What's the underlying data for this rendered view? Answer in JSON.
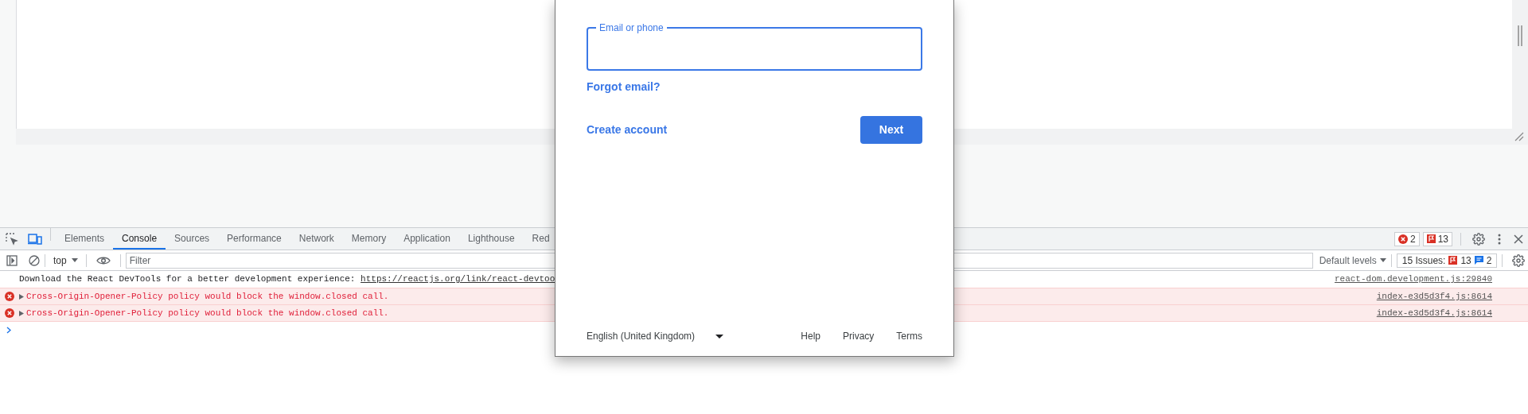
{
  "signin_dialog": {
    "email_field": {
      "label": "Email or phone"
    },
    "forgot_link": "Forgot email?",
    "create_account_link": "Create account",
    "next_button": "Next",
    "language_select": {
      "value": "English (United Kingdom)"
    },
    "footer_links": [
      "Help",
      "Privacy",
      "Terms"
    ]
  },
  "devtools": {
    "tabs": [
      {
        "label": "Elements",
        "selected": false
      },
      {
        "label": "Console",
        "selected": true
      },
      {
        "label": "Sources",
        "selected": false
      },
      {
        "label": "Performance",
        "selected": false
      },
      {
        "label": "Network",
        "selected": false
      },
      {
        "label": "Memory",
        "selected": false
      },
      {
        "label": "Application",
        "selected": false
      },
      {
        "label": "Lighthouse",
        "selected": false
      },
      {
        "label": "Red",
        "selected": false
      }
    ],
    "error_count": "2",
    "issue_count": "13",
    "toolbar": {
      "context": "top",
      "filter": {
        "placeholder": "Filter"
      },
      "levels": "Default levels",
      "issues": {
        "label": "15 Issues:",
        "errors": "13",
        "infos": "2"
      }
    },
    "messages": [
      {
        "kind": "info",
        "text": "Download the React DevTools for a better development experience: ",
        "link": "https://reactjs.org/link/react-devtoo",
        "source": "react-dom.development.js:29840"
      },
      {
        "kind": "error",
        "text": "Cross-Origin-Opener-Policy policy would block the window.closed call.",
        "source": "index-e3d5d3f4.js:8614"
      },
      {
        "kind": "error",
        "text": "Cross-Origin-Opener-Policy policy would block the window.closed call.",
        "source": "index-e3d5d3f4.js:8614"
      }
    ]
  }
}
